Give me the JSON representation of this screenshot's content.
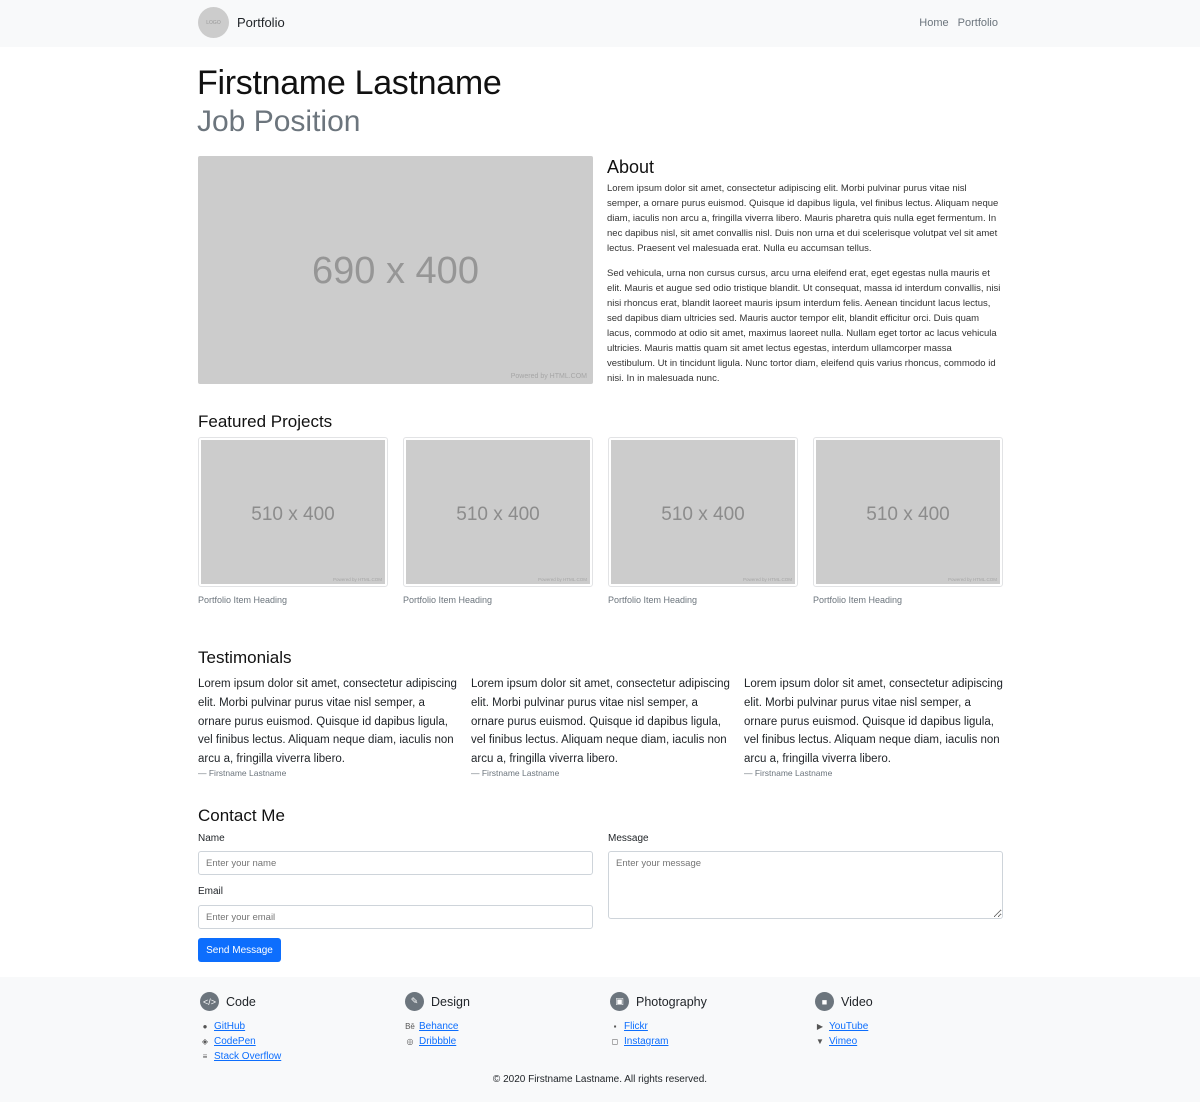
{
  "nav": {
    "logo_text": "LOGO",
    "brand": "Portfolio",
    "links": [
      "Home",
      "Portfolio"
    ]
  },
  "hero": {
    "name": "Firstname Lastname",
    "job": "Job Position",
    "image_label": "690 x 400",
    "image_credit": "Powered by HTML.COM"
  },
  "about": {
    "title": "About",
    "paragraphs": [
      "Lorem ipsum dolor sit amet, consectetur adipiscing elit. Morbi pulvinar purus vitae nisl semper, a ornare purus euismod. Quisque id dapibus ligula, vel finibus lectus. Aliquam neque diam, iaculis non arcu a, fringilla viverra libero. Mauris pharetra quis nulla eget fermentum. In nec dapibus nisl, sit amet convallis nisl. Duis non urna et dui scelerisque volutpat vel sit amet lectus. Praesent vel malesuada erat. Nulla eu accumsan tellus.",
      "Sed vehicula, urna non cursus cursus, arcu urna eleifend erat, eget egestas nulla mauris et elit. Mauris et augue sed odio tristique blandit. Ut consequat, massa id interdum convallis, nisi nisi rhoncus erat, blandit laoreet mauris ipsum interdum felis. Aenean tincidunt lacus lectus, sed dapibus diam ultricies sed. Mauris auctor tempor elit, blandit efficitur orci. Duis quam lacus, commodo at odio sit amet, maximus laoreet nulla. Nullam eget tortor ac lacus vehicula ultricies. Mauris mattis quam sit amet lectus egestas, interdum ullamcorper massa vestibulum. Ut in tincidunt ligula. Nunc tortor diam, eleifend quis varius rhoncus, commodo id nisi. In in malesuada nunc."
    ]
  },
  "projects": {
    "title": "Featured Projects",
    "items": [
      {
        "image_label": "510 x 400",
        "credit": "Powered by HTML.COM",
        "caption": "Portfolio Item Heading"
      },
      {
        "image_label": "510 x 400",
        "credit": "Powered by HTML.COM",
        "caption": "Portfolio Item Heading"
      },
      {
        "image_label": "510 x 400",
        "credit": "Powered by HTML.COM",
        "caption": "Portfolio Item Heading"
      },
      {
        "image_label": "510 x 400",
        "credit": "Powered by HTML.COM",
        "caption": "Portfolio Item Heading"
      }
    ]
  },
  "testimonials": {
    "title": "Testimonials",
    "items": [
      {
        "quote": "Lorem ipsum dolor sit amet, consectetur adipiscing elit. Morbi pulvinar purus vitae nisl semper, a ornare purus euismod. Quisque id dapibus ligula, vel finibus lectus. Aliquam neque diam, iaculis non arcu a, fringilla viverra libero.",
        "author": "— Firstname Lastname"
      },
      {
        "quote": "Lorem ipsum dolor sit amet, consectetur adipiscing elit. Morbi pulvinar purus vitae nisl semper, a ornare purus euismod. Quisque id dapibus ligula, vel finibus lectus. Aliquam neque diam, iaculis non arcu a, fringilla viverra libero.",
        "author": "— Firstname Lastname"
      },
      {
        "quote": "Lorem ipsum dolor sit amet, consectetur adipiscing elit. Morbi pulvinar purus vitae nisl semper, a ornare purus euismod. Quisque id dapibus ligula, vel finibus lectus. Aliquam neque diam, iaculis non arcu a, fringilla viverra libero.",
        "author": "— Firstname Lastname"
      }
    ]
  },
  "contact": {
    "title": "Contact Me",
    "name_label": "Name",
    "name_placeholder": "Enter your name",
    "email_label": "Email",
    "email_placeholder": "Enter your email",
    "message_label": "Message",
    "message_placeholder": "Enter your message",
    "send_label": "Send Message"
  },
  "footer": {
    "columns": [
      {
        "title": "Code",
        "icon": "code-icon",
        "links": [
          {
            "icon": "github-icon",
            "label": "GitHub"
          },
          {
            "icon": "codepen-icon",
            "label": "CodePen"
          },
          {
            "icon": "stackoverflow-icon",
            "label": "Stack Overflow"
          }
        ]
      },
      {
        "title": "Design",
        "icon": "brush-icon",
        "links": [
          {
            "icon": "behance-icon",
            "label": "Behance"
          },
          {
            "icon": "dribbble-icon",
            "label": "Dribbble"
          }
        ]
      },
      {
        "title": "Photography",
        "icon": "image-icon",
        "links": [
          {
            "icon": "flickr-icon",
            "label": "Flickr"
          },
          {
            "icon": "instagram-icon",
            "label": "Instagram"
          }
        ]
      },
      {
        "title": "Video",
        "icon": "video-icon",
        "links": [
          {
            "icon": "youtube-icon",
            "label": "YouTube"
          },
          {
            "icon": "vimeo-icon",
            "label": "Vimeo"
          }
        ]
      }
    ],
    "copyright": "© 2020 Firstname Lastname. All rights reserved."
  },
  "colors": {
    "accent": "#0d6efd",
    "light_bg": "#f8f9fa",
    "muted": "#6c757d",
    "placeholder": "#cccccc"
  }
}
